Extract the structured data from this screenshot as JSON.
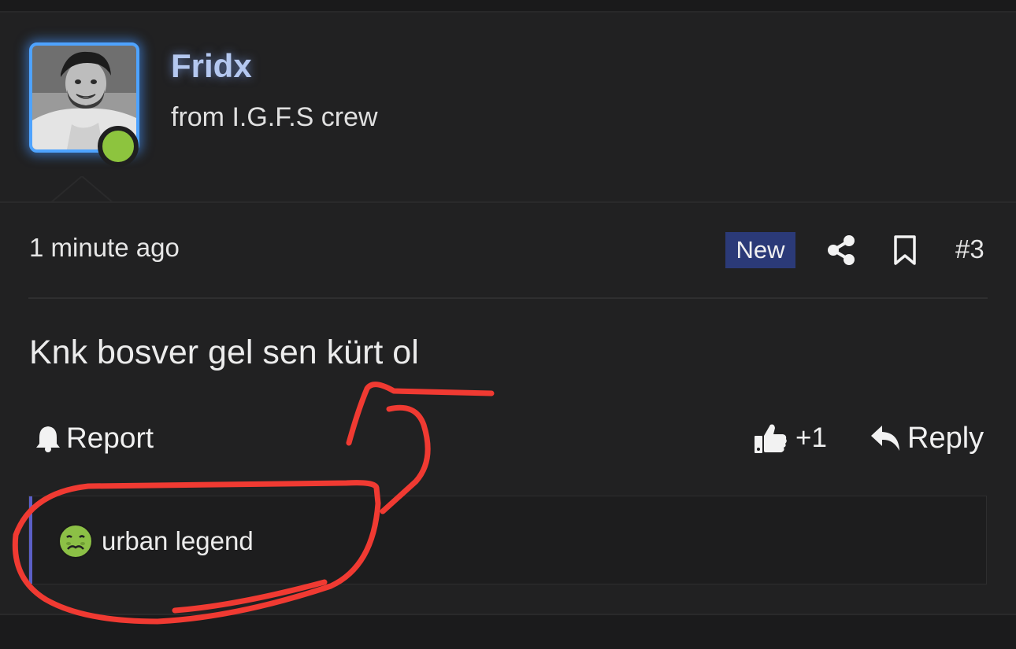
{
  "author": {
    "username": "Fridx",
    "title": "from I.G.F.S crew",
    "online": true,
    "avatar": "avatar-photo"
  },
  "post": {
    "timestamp": "1 minute ago",
    "badge": "New",
    "number": "#3",
    "body": "Knk bosver gel sen kürt ol",
    "icons": {
      "share": "share-icon",
      "bookmark": "bookmark-icon"
    }
  },
  "actions": {
    "report_label": "Report",
    "like_count": "+1",
    "reply_label": "Reply",
    "icons": {
      "report": "bell-icon",
      "like": "thumbs-up-icon",
      "reply": "reply-icon"
    }
  },
  "reactions": [
    {
      "icon": "nauseated-face-icon",
      "label": "urban legend"
    }
  ],
  "colors": {
    "background": "#1c1c1d",
    "panel": "#212122",
    "username": "#b4c8f0",
    "avatar_glow": "#4ea3ff",
    "online": "#8dc43e",
    "badge_bg": "#2b3a78",
    "reaction_accent": "#5b5fc7",
    "annotation": "#f03a32"
  }
}
